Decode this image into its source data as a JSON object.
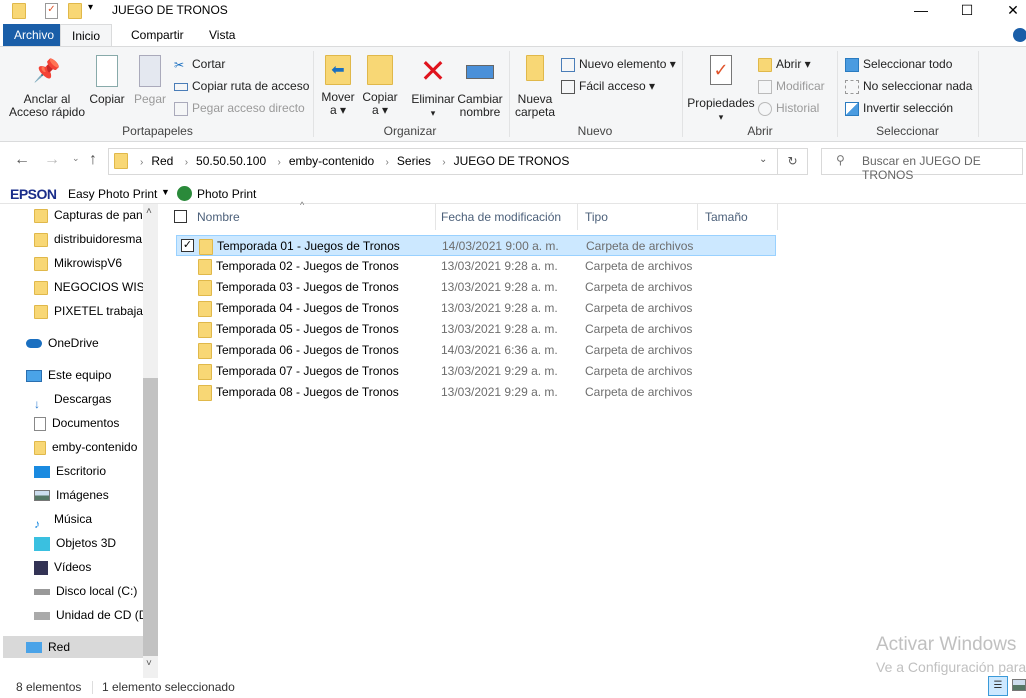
{
  "window": {
    "title": "JUEGO DE TRONOS",
    "minimize": "—",
    "maximize": "☐",
    "close": "✕"
  },
  "tabs": [
    {
      "label": "Archivo"
    },
    {
      "label": "Inicio"
    },
    {
      "label": "Compartir"
    },
    {
      "label": "Vista"
    }
  ],
  "ribbon": {
    "portapapeles": {
      "label": "Portapapeles",
      "anclar": "Anclar al Acceso rápido",
      "copiar": "Copiar",
      "pegar": "Pegar",
      "cortar": "Cortar",
      "copiar_ruta": "Copiar ruta de acceso",
      "pegar_acceso": "Pegar acceso directo"
    },
    "organizar": {
      "label": "Organizar",
      "mover": "Mover a ▾",
      "copiar_a": "Copiar a ▾",
      "eliminar": "Eliminar",
      "eliminar_arrow": "▾",
      "cambiar": "Cambiar nombre"
    },
    "nuevo": {
      "label": "Nuevo",
      "nueva_carpeta": "Nueva carpeta",
      "nuevo_elemento": "Nuevo elemento ▾",
      "facil_acceso": "Fácil acceso ▾"
    },
    "abrir": {
      "label": "Abrir",
      "propiedades": "Propiedades",
      "propiedades_arrow": "▾",
      "abrir": "Abrir ▾",
      "modificar": "Modificar",
      "historial": "Historial"
    },
    "seleccionar": {
      "label": "Seleccionar",
      "todo": "Seleccionar todo",
      "nada": "No seleccionar nada",
      "invertir": "Invertir selección"
    }
  },
  "address": {
    "crumbs": [
      "Red",
      "50.50.50.100",
      "emby-contenido",
      "Series",
      "JUEGO DE TRONOS"
    ],
    "search_placeholder": "Buscar en JUEGO DE TRONOS"
  },
  "epson": {
    "brand": "EPSON",
    "easy": "Easy Photo Print",
    "photo": "Photo Print"
  },
  "nav": [
    {
      "label": "Capturas de pan",
      "icon": "shared-folder-icon"
    },
    {
      "label": "distribuidoresma",
      "icon": "shared-folder-icon"
    },
    {
      "label": "MikrowispV6",
      "icon": "shared-folder-icon"
    },
    {
      "label": "NEGOCIOS WISP",
      "icon": "shared-folder-icon"
    },
    {
      "label": "PIXETEL trabajad",
      "icon": "shared-folder-icon"
    },
    {
      "label": "OneDrive",
      "icon": "cloud-icon"
    },
    {
      "label": "Este equipo",
      "icon": "computer-icon"
    },
    {
      "label": "Descargas",
      "icon": "download-icon"
    },
    {
      "label": "Documentos",
      "icon": "document-icon"
    },
    {
      "label": "emby-contenido",
      "icon": "network-drive-icon"
    },
    {
      "label": "Escritorio",
      "icon": "desktop-icon"
    },
    {
      "label": "Imágenes",
      "icon": "pictures-icon"
    },
    {
      "label": "Música",
      "icon": "music-icon"
    },
    {
      "label": "Objetos 3D",
      "icon": "cube-icon"
    },
    {
      "label": "Vídeos",
      "icon": "video-icon"
    },
    {
      "label": "Disco local (C:)",
      "icon": "disk-icon"
    },
    {
      "label": "Unidad de CD (D",
      "icon": "cd-icon"
    },
    {
      "label": "Red",
      "icon": "network-icon"
    }
  ],
  "columns": {
    "name": "Nombre",
    "date": "Fecha de modificación",
    "type": "Tipo",
    "size": "Tamaño"
  },
  "files": [
    {
      "name": "Temporada 01 - Juegos de Tronos",
      "date": "14/03/2021 9:00 a. m.",
      "type": "Carpeta de archivos",
      "selected": true
    },
    {
      "name": "Temporada 02 - Juegos de Tronos",
      "date": "13/03/2021 9:28 a. m.",
      "type": "Carpeta de archivos"
    },
    {
      "name": "Temporada 03 - Juegos de Tronos",
      "date": "13/03/2021 9:28 a. m.",
      "type": "Carpeta de archivos"
    },
    {
      "name": "Temporada 04 - Juegos de Tronos",
      "date": "13/03/2021 9:28 a. m.",
      "type": "Carpeta de archivos"
    },
    {
      "name": "Temporada 05 - Juegos de Tronos",
      "date": "13/03/2021 9:28 a. m.",
      "type": "Carpeta de archivos"
    },
    {
      "name": "Temporada 06 - Juegos de Tronos",
      "date": "14/03/2021 6:36 a. m.",
      "type": "Carpeta de archivos"
    },
    {
      "name": "Temporada 07 - Juegos de Tronos",
      "date": "13/03/2021 9:29 a. m.",
      "type": "Carpeta de archivos"
    },
    {
      "name": "Temporada 08 - Juegos de Tronos",
      "date": "13/03/2021 9:29 a. m.",
      "type": "Carpeta de archivos"
    }
  ],
  "status": {
    "count": "8 elementos",
    "selected": "1 elemento seleccionado"
  },
  "watermark": {
    "title": "Activar Windows",
    "sub": "Ve a Configuración para"
  }
}
